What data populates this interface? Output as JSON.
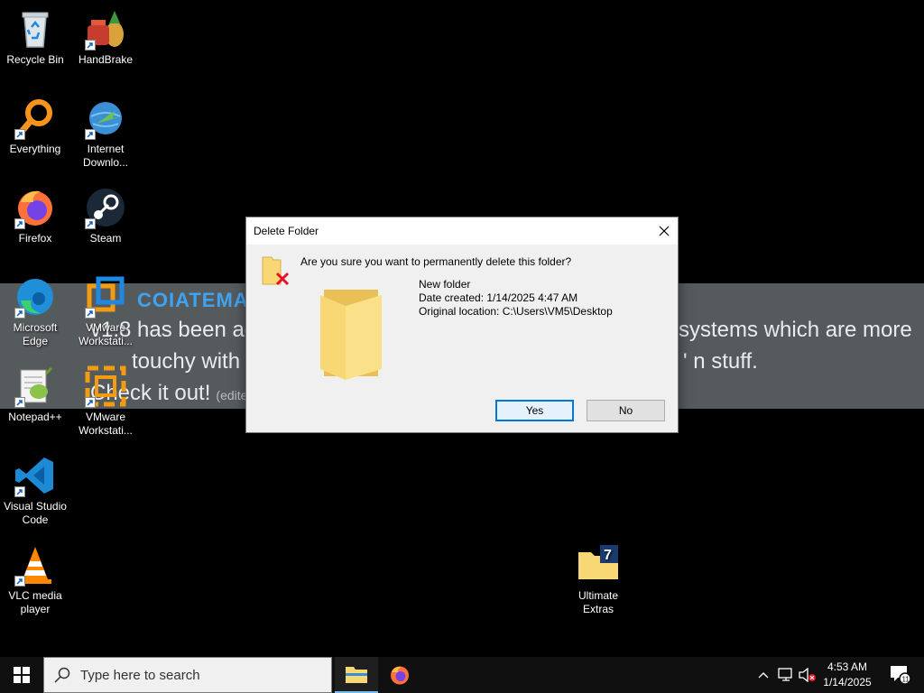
{
  "wallpaper": {
    "title": "COIATEMA",
    "line1": "v1.8 has been ad",
    "line2": "touchy with mod",
    "line3": "Check it out!",
    "edited": "(edite",
    "line4": "systems which are more",
    "line5": "' n stuff."
  },
  "desktop_icons": [
    {
      "label": "Recycle Bin"
    },
    {
      "label": "HandBrake"
    },
    {
      "label": "Everything"
    },
    {
      "label": "Internet Downlo..."
    },
    {
      "label": "Firefox"
    },
    {
      "label": "Steam"
    },
    {
      "label": "Microsoft Edge"
    },
    {
      "label": "VMware Workstati..."
    },
    {
      "label": "Notepad++"
    },
    {
      "label": "VMware Workstati..."
    },
    {
      "label": "Visual Studio Code"
    },
    {
      "label": "VLC media player"
    },
    {
      "label": "Ultimate Extras"
    }
  ],
  "dialog": {
    "title": "Delete Folder",
    "question": "Are you sure you want to permanently delete this folder?",
    "folder_name": "New folder",
    "date_created": "Date created: 1/14/2025 4:47 AM",
    "original_location": "Original location: C:\\Users\\VM5\\Desktop",
    "yes_label": "Yes",
    "no_label": "No"
  },
  "taskbar": {
    "search_placeholder": "Type here to search",
    "time": "4:53 AM",
    "date": "1/14/2025",
    "notification_count": "11"
  },
  "colors": {
    "accent": "#0078d7",
    "folder_yellow": "#f8d775",
    "taskbar": "#101010"
  }
}
